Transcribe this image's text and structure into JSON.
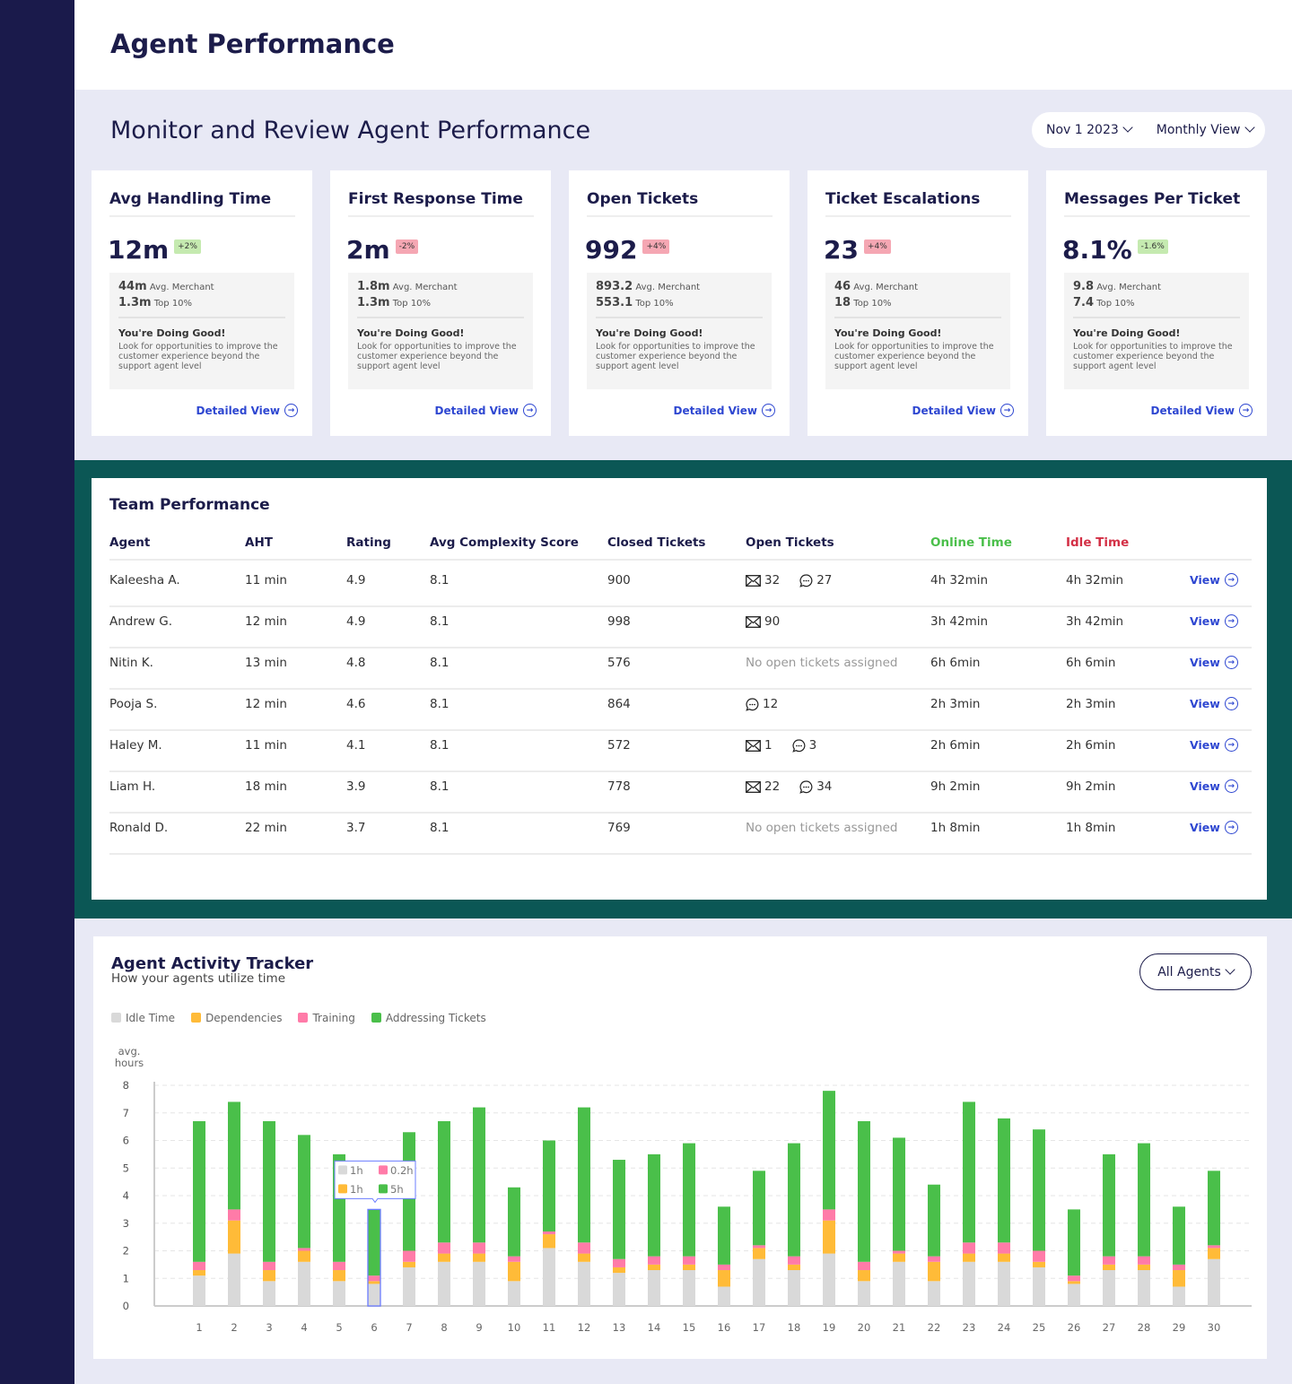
{
  "header": {
    "title": "Agent Performance"
  },
  "page": {
    "subtitle": "Monitor and Review Agent Performance",
    "date_filter": "Nov 1 2023",
    "view_filter": "Monthly View"
  },
  "colors": {
    "sidebar": "#1a1a4b",
    "teal": "#0b5755",
    "accent": "#2e47d1",
    "online": "#4abf4a",
    "idle": "#d32f45",
    "idle_bar": "#d9d9d9",
    "dependencies": "#ffbb38",
    "training": "#ff7ba8",
    "addressing": "#4abf4a"
  },
  "cards": [
    {
      "title": "Avg Handling Time",
      "value": "12m",
      "change": "+2%",
      "dir": "up",
      "avg": "44m",
      "avg_label": "Avg. Merchant",
      "top": "1.3m",
      "top_label": "Top 10%",
      "msg": "You're Doing Good!",
      "desc": "Look for opportunities to improve the customer experience beyond the support agent level",
      "link": "Detailed View"
    },
    {
      "title": "First Response Time",
      "value": "2m",
      "change": "-2%",
      "dir": "down",
      "avg": "1.8m",
      "avg_label": "Avg. Merchant",
      "top": "1.3m",
      "top_label": "Top 10%",
      "msg": "You're Doing Good!",
      "desc": "Look for opportunities to improve the customer experience beyond the support agent level",
      "link": "Detailed View"
    },
    {
      "title": "Open Tickets",
      "value": "992",
      "change": "+4%",
      "dir": "down",
      "avg": "893.2",
      "avg_label": "Avg. Merchant",
      "top": "553.1",
      "top_label": "Top 10%",
      "msg": "You're Doing Good!",
      "desc": "Look for opportunities to improve the customer experience beyond the support agent level",
      "link": "Detailed View"
    },
    {
      "title": "Ticket Escalations",
      "value": "23",
      "change": "+4%",
      "dir": "down",
      "avg": "46",
      "avg_label": "Avg. Merchant",
      "top": "18",
      "top_label": "Top 10%",
      "msg": "You're Doing Good!",
      "desc": "Look for opportunities to improve the customer experience beyond the support agent level",
      "link": "Detailed View"
    },
    {
      "title": "Messages Per Ticket",
      "value": "8.1%",
      "change": "-1.6%",
      "dir": "up",
      "avg": "9.8",
      "avg_label": "Avg. Merchant",
      "top": "7.4",
      "top_label": "Top 10%",
      "msg": "You're Doing Good!",
      "desc": "Look for opportunities to improve the customer experience beyond the support agent level",
      "link": "Detailed View"
    }
  ],
  "team": {
    "title": "Team Performance",
    "columns": [
      "Agent",
      "AHT",
      "Rating",
      "Avg Complexity Score",
      "Closed Tickets",
      "Open Tickets",
      "Online Time",
      "Idle Time"
    ],
    "view_label": "View",
    "no_tickets": "No open tickets assigned",
    "rows": [
      {
        "agent": "Kaleesha A.",
        "aht": "11 min",
        "rating": "4.9",
        "complexity": "8.1",
        "closed": "900",
        "email": "32",
        "chat": "27",
        "online": "4h 32min",
        "idle": "4h 32min"
      },
      {
        "agent": "Andrew G.",
        "aht": "12 min",
        "rating": "4.9",
        "complexity": "8.1",
        "closed": "998",
        "email": "90",
        "chat": null,
        "online": "3h 42min",
        "idle": "3h 42min"
      },
      {
        "agent": "Nitin K.",
        "aht": "13 min",
        "rating": "4.8",
        "complexity": "8.1",
        "closed": "576",
        "email": null,
        "chat": null,
        "online": "6h 6min",
        "idle": "6h 6min"
      },
      {
        "agent": "Pooja S.",
        "aht": "12 min",
        "rating": "4.6",
        "complexity": "8.1",
        "closed": "864",
        "email": null,
        "chat": "12",
        "online": "2h 3min",
        "idle": "2h 3min"
      },
      {
        "agent": "Haley M.",
        "aht": "11 min",
        "rating": "4.1",
        "complexity": "8.1",
        "closed": "572",
        "email": "1",
        "chat": "3",
        "online": "2h 6min",
        "idle": "2h 6min"
      },
      {
        "agent": "Liam H.",
        "aht": "18 min",
        "rating": "3.9",
        "complexity": "8.1",
        "closed": "778",
        "email": "22",
        "chat": "34",
        "online": "9h 2min",
        "idle": "9h 2min"
      },
      {
        "agent": "Ronald D.",
        "aht": "22 min",
        "rating": "3.7",
        "complexity": "8.1",
        "closed": "769",
        "email": null,
        "chat": null,
        "online": "1h 8min",
        "idle": "1h 8min"
      }
    ]
  },
  "tracker": {
    "title": "Agent Activity Tracker",
    "subtitle": "How your agents utilize time",
    "agent_filter": "All Agents"
  },
  "chart_data": {
    "type": "bar",
    "stacked": true,
    "ylabel": "avg. hours",
    "ylim": [
      0,
      8
    ],
    "yticks": [
      0,
      1,
      2,
      3,
      4,
      5,
      6,
      7,
      8
    ],
    "grid": true,
    "legend_placement": "top-left",
    "categories": [
      "1",
      "2",
      "3",
      "4",
      "5",
      "6",
      "7",
      "8",
      "9",
      "10",
      "11",
      "12",
      "13",
      "14",
      "15",
      "16",
      "17",
      "18",
      "19",
      "20",
      "21",
      "22",
      "23",
      "24",
      "25",
      "26",
      "27",
      "28",
      "29",
      "30"
    ],
    "series": [
      {
        "name": "Idle Time",
        "color": "#d9d9d9",
        "values": [
          1.1,
          1.9,
          0.9,
          1.6,
          0.9,
          0.8,
          1.4,
          1.6,
          1.6,
          0.9,
          2.1,
          1.6,
          1.2,
          1.3,
          1.3,
          0.7,
          1.7,
          1.3,
          1.9,
          0.9,
          1.6,
          0.9,
          1.6,
          1.6,
          1.4,
          0.8,
          1.3,
          1.3,
          0.7,
          1.7
        ]
      },
      {
        "name": "Dependencies",
        "color": "#ffbb38",
        "values": [
          0.2,
          1.2,
          0.4,
          0.4,
          0.4,
          0.1,
          0.2,
          0.3,
          0.3,
          0.7,
          0.5,
          0.3,
          0.2,
          0.2,
          0.2,
          0.6,
          0.4,
          0.2,
          1.2,
          0.4,
          0.3,
          0.7,
          0.3,
          0.3,
          0.2,
          0.1,
          0.2,
          0.2,
          0.6,
          0.4
        ]
      },
      {
        "name": "Training",
        "color": "#ff7ba8",
        "values": [
          0.3,
          0.4,
          0.3,
          0.1,
          0.3,
          0.2,
          0.4,
          0.4,
          0.4,
          0.2,
          0.1,
          0.4,
          0.3,
          0.3,
          0.3,
          0.2,
          0.1,
          0.3,
          0.4,
          0.3,
          0.1,
          0.2,
          0.4,
          0.4,
          0.4,
          0.2,
          0.3,
          0.3,
          0.2,
          0.1
        ]
      },
      {
        "name": "Addressing Tickets",
        "color": "#4abf4a",
        "values": [
          5.1,
          3.9,
          5.1,
          4.1,
          3.9,
          2.4,
          4.3,
          4.4,
          4.9,
          2.5,
          3.3,
          4.9,
          3.6,
          3.7,
          4.1,
          2.1,
          2.7,
          4.1,
          4.3,
          5.1,
          4.1,
          2.6,
          5.1,
          4.5,
          4.4,
          2.4,
          3.7,
          4.1,
          2.1,
          2.7
        ]
      }
    ],
    "highlighted": "6",
    "tooltip": {
      "idle": "1h",
      "dependencies": "1h",
      "training": "0.2h",
      "addressing": "5h"
    }
  }
}
